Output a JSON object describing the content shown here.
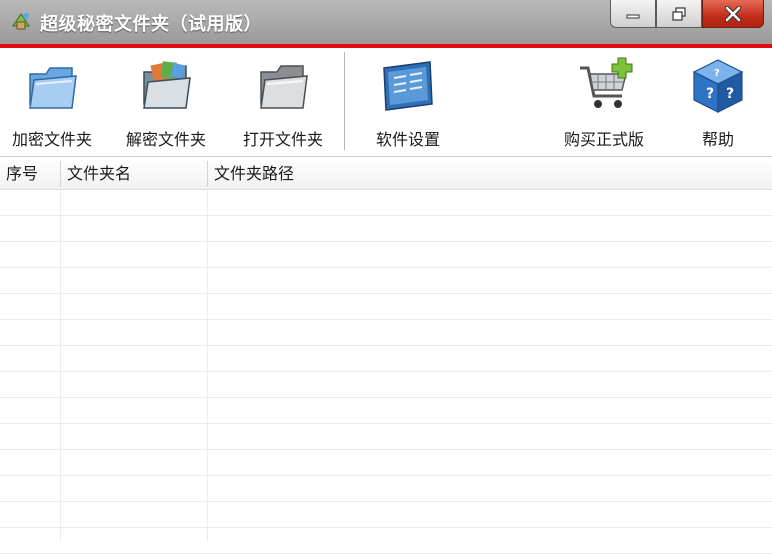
{
  "window": {
    "title": "超级秘密文件夹（试用版）",
    "controls": [
      "minimize",
      "restore",
      "close"
    ]
  },
  "toolbar": {
    "items": [
      {
        "label": "加密文件夹",
        "icon": "folder-blue-icon"
      },
      {
        "label": "解密文件夹",
        "icon": "folder-photos-icon"
      },
      {
        "label": "打开文件夹",
        "icon": "folder-open-icon"
      },
      {
        "label": "软件设置",
        "icon": "settings-screen-icon"
      },
      {
        "label": "购买正式版",
        "icon": "shopping-cart-icon"
      },
      {
        "label": "帮助",
        "icon": "help-cube-icon"
      }
    ]
  },
  "table": {
    "columns": [
      "序号",
      "文件夹名",
      "文件夹路径"
    ],
    "rows": []
  },
  "colors": {
    "accent_red": "#e30a14",
    "titlebar": "#a8a8a8",
    "close_button": "#c32d1a"
  }
}
